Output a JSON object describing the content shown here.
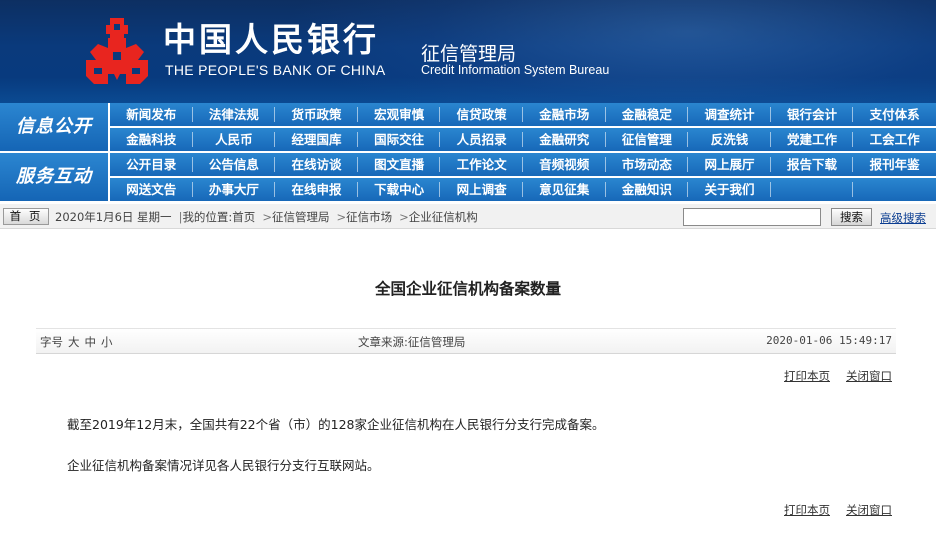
{
  "header": {
    "bank_name_cn": "中国人民银行",
    "bank_name_en": "THE PEOPLE'S BANK OF CHINA",
    "dept_cn": "征信管理局",
    "dept_en": "Credit Information System Bureau",
    "logo_icon": "pboc-emblem-icon",
    "logo_color": "#e8251f",
    "background_color": "#0a3a7c"
  },
  "nav": {
    "accent_color": "#1d74c4",
    "groups": [
      {
        "title": "信息公开",
        "rows": [
          [
            "新闻发布",
            "法律法规",
            "货币政策",
            "宏观审慎",
            "信贷政策",
            "金融市场",
            "金融稳定",
            "调查统计",
            "银行会计",
            "支付体系"
          ],
          [
            "金融科技",
            "人民币",
            "经理国库",
            "国际交往",
            "人员招录",
            "金融研究",
            "征信管理",
            "反洗钱",
            "党建工作",
            "工会工作"
          ]
        ]
      },
      {
        "title": "服务互动",
        "rows": [
          [
            "公开目录",
            "公告信息",
            "在线访谈",
            "图文直播",
            "工作论文",
            "音频视频",
            "市场动态",
            "网上展厅",
            "报告下载",
            "报刊年鉴"
          ],
          [
            "网送文告",
            "办事大厅",
            "在线申报",
            "下载中心",
            "网上调查",
            "意见征集",
            "金融知识",
            "关于我们"
          ]
        ]
      }
    ]
  },
  "breadcrumb": {
    "home_label": "首 页",
    "date": "2020年1月6日 星期一",
    "location_label": "我的位置:首页",
    "items": [
      "征信管理局",
      "征信市场",
      "企业征信机构"
    ],
    "separator": ">",
    "divider": "|"
  },
  "search": {
    "value": "",
    "button_label": "搜索",
    "advanced_label": "高级搜索"
  },
  "article": {
    "title": "全国企业征信机构备案数量",
    "font_size_label": "字号",
    "font_sizes": [
      "大",
      "中",
      "小"
    ],
    "source": "文章来源:征信管理局",
    "timestamp": "2020-01-06 15:49:17",
    "print_label": "打印本页",
    "close_label": "关闭窗口",
    "paragraphs": [
      "截至2019年12月末，全国共有22个省（市）的128家企业征信机构在人民银行分支行完成备案。",
      "企业征信机构备案情况详见各人民银行分支行互联网站。"
    ]
  }
}
